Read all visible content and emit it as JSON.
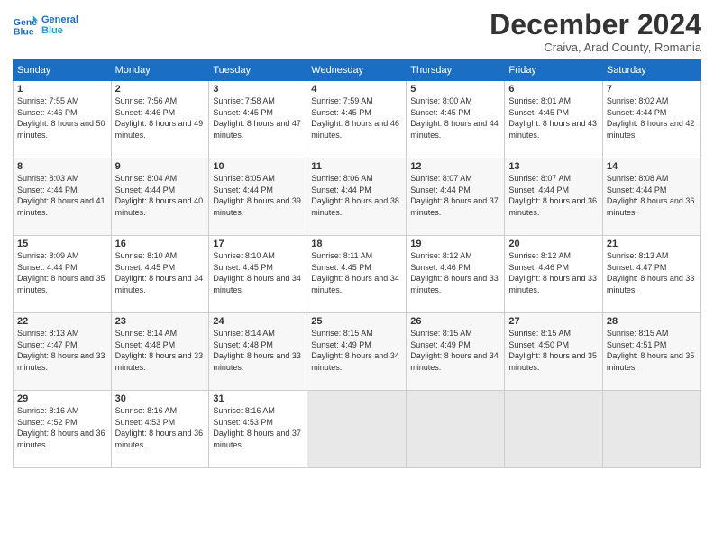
{
  "header": {
    "logo_line1": "General",
    "logo_line2": "Blue",
    "month": "December 2024",
    "location": "Craiva, Arad County, Romania"
  },
  "weekdays": [
    "Sunday",
    "Monday",
    "Tuesday",
    "Wednesday",
    "Thursday",
    "Friday",
    "Saturday"
  ],
  "weeks": [
    [
      {
        "day": "1",
        "sunrise": "7:55 AM",
        "sunset": "4:46 PM",
        "daylight": "8 hours and 50 minutes."
      },
      {
        "day": "2",
        "sunrise": "7:56 AM",
        "sunset": "4:46 PM",
        "daylight": "8 hours and 49 minutes."
      },
      {
        "day": "3",
        "sunrise": "7:58 AM",
        "sunset": "4:45 PM",
        "daylight": "8 hours and 47 minutes."
      },
      {
        "day": "4",
        "sunrise": "7:59 AM",
        "sunset": "4:45 PM",
        "daylight": "8 hours and 46 minutes."
      },
      {
        "day": "5",
        "sunrise": "8:00 AM",
        "sunset": "4:45 PM",
        "daylight": "8 hours and 44 minutes."
      },
      {
        "day": "6",
        "sunrise": "8:01 AM",
        "sunset": "4:45 PM",
        "daylight": "8 hours and 43 minutes."
      },
      {
        "day": "7",
        "sunrise": "8:02 AM",
        "sunset": "4:44 PM",
        "daylight": "8 hours and 42 minutes."
      }
    ],
    [
      {
        "day": "8",
        "sunrise": "8:03 AM",
        "sunset": "4:44 PM",
        "daylight": "8 hours and 41 minutes."
      },
      {
        "day": "9",
        "sunrise": "8:04 AM",
        "sunset": "4:44 PM",
        "daylight": "8 hours and 40 minutes."
      },
      {
        "day": "10",
        "sunrise": "8:05 AM",
        "sunset": "4:44 PM",
        "daylight": "8 hours and 39 minutes."
      },
      {
        "day": "11",
        "sunrise": "8:06 AM",
        "sunset": "4:44 PM",
        "daylight": "8 hours and 38 minutes."
      },
      {
        "day": "12",
        "sunrise": "8:07 AM",
        "sunset": "4:44 PM",
        "daylight": "8 hours and 37 minutes."
      },
      {
        "day": "13",
        "sunrise": "8:07 AM",
        "sunset": "4:44 PM",
        "daylight": "8 hours and 36 minutes."
      },
      {
        "day": "14",
        "sunrise": "8:08 AM",
        "sunset": "4:44 PM",
        "daylight": "8 hours and 36 minutes."
      }
    ],
    [
      {
        "day": "15",
        "sunrise": "8:09 AM",
        "sunset": "4:44 PM",
        "daylight": "8 hours and 35 minutes."
      },
      {
        "day": "16",
        "sunrise": "8:10 AM",
        "sunset": "4:45 PM",
        "daylight": "8 hours and 34 minutes."
      },
      {
        "day": "17",
        "sunrise": "8:10 AM",
        "sunset": "4:45 PM",
        "daylight": "8 hours and 34 minutes."
      },
      {
        "day": "18",
        "sunrise": "8:11 AM",
        "sunset": "4:45 PM",
        "daylight": "8 hours and 34 minutes."
      },
      {
        "day": "19",
        "sunrise": "8:12 AM",
        "sunset": "4:46 PM",
        "daylight": "8 hours and 33 minutes."
      },
      {
        "day": "20",
        "sunrise": "8:12 AM",
        "sunset": "4:46 PM",
        "daylight": "8 hours and 33 minutes."
      },
      {
        "day": "21",
        "sunrise": "8:13 AM",
        "sunset": "4:47 PM",
        "daylight": "8 hours and 33 minutes."
      }
    ],
    [
      {
        "day": "22",
        "sunrise": "8:13 AM",
        "sunset": "4:47 PM",
        "daylight": "8 hours and 33 minutes."
      },
      {
        "day": "23",
        "sunrise": "8:14 AM",
        "sunset": "4:48 PM",
        "daylight": "8 hours and 33 minutes."
      },
      {
        "day": "24",
        "sunrise": "8:14 AM",
        "sunset": "4:48 PM",
        "daylight": "8 hours and 33 minutes."
      },
      {
        "day": "25",
        "sunrise": "8:15 AM",
        "sunset": "4:49 PM",
        "daylight": "8 hours and 34 minutes."
      },
      {
        "day": "26",
        "sunrise": "8:15 AM",
        "sunset": "4:49 PM",
        "daylight": "8 hours and 34 minutes."
      },
      {
        "day": "27",
        "sunrise": "8:15 AM",
        "sunset": "4:50 PM",
        "daylight": "8 hours and 35 minutes."
      },
      {
        "day": "28",
        "sunrise": "8:15 AM",
        "sunset": "4:51 PM",
        "daylight": "8 hours and 35 minutes."
      }
    ],
    [
      {
        "day": "29",
        "sunrise": "8:16 AM",
        "sunset": "4:52 PM",
        "daylight": "8 hours and 36 minutes."
      },
      {
        "day": "30",
        "sunrise": "8:16 AM",
        "sunset": "4:53 PM",
        "daylight": "8 hours and 36 minutes."
      },
      {
        "day": "31",
        "sunrise": "8:16 AM",
        "sunset": "4:53 PM",
        "daylight": "8 hours and 37 minutes."
      },
      null,
      null,
      null,
      null
    ]
  ]
}
